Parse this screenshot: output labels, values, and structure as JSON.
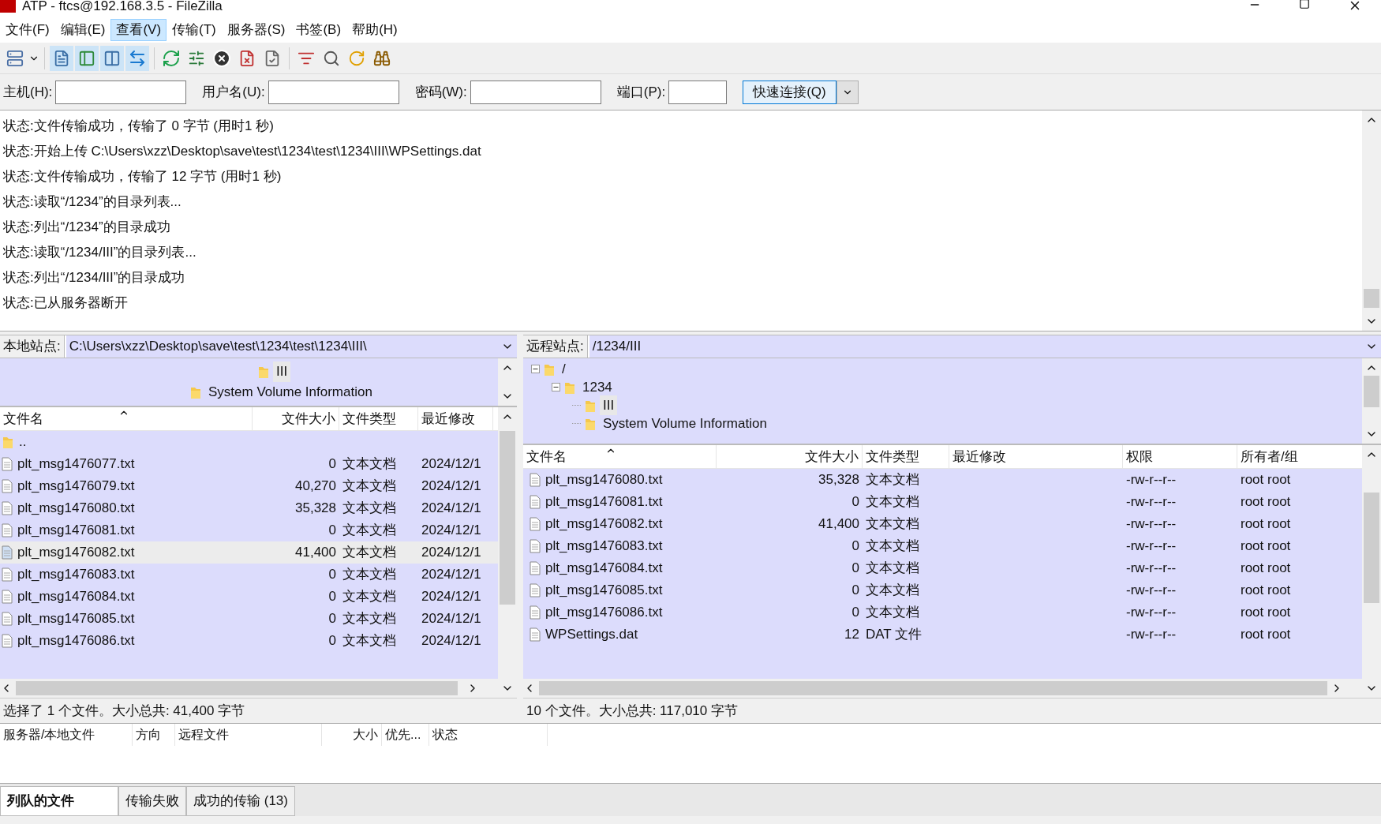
{
  "window": {
    "title": "ATP - ftcs@192.168.3.5 - FileZilla"
  },
  "menu": [
    {
      "label": "文件(F)",
      "selected": false
    },
    {
      "label": "编辑(E)",
      "selected": false
    },
    {
      "label": "查看(V)",
      "selected": true
    },
    {
      "label": "传输(T)",
      "selected": false
    },
    {
      "label": "服务器(S)",
      "selected": false
    },
    {
      "label": "书签(B)",
      "selected": false
    },
    {
      "label": "帮助(H)",
      "selected": false
    }
  ],
  "quickconnect": {
    "fields": [
      {
        "label": "主机(H):"
      },
      {
        "label": "用户名(U):"
      },
      {
        "label": "密码(W):"
      },
      {
        "label": "端口(P):"
      }
    ],
    "button": "快速连接(Q)"
  },
  "log": [
    "状态:文件传输成功，传输了 0 字节 (用时1 秒)",
    "状态:开始上传 C:\\Users\\xzz\\Desktop\\save\\test\\1234\\test\\1234\\III\\WPSettings.dat",
    "状态:文件传输成功，传输了 12 字节 (用时1 秒)",
    "状态:读取“/1234”的目录列表...",
    "状态:列出“/1234”的目录成功",
    "状态:读取“/1234/III”的目录列表...",
    "状态:列出“/1234/III”的目录成功",
    "状态:已从服务器断开"
  ],
  "local": {
    "label": "本地站点:",
    "path": "C:\\Users\\xzz\\Desktop\\save\\test\\1234\\test\\1234\\III\\",
    "tree": [
      {
        "name": "III",
        "selected": true
      },
      {
        "name": "System Volume Information",
        "selected": false
      }
    ],
    "columns": [
      "文件名",
      "文件大小",
      "文件类型",
      "最近修改"
    ],
    "rows": [
      {
        "kind": "folder",
        "name": "..",
        "size": "",
        "type": "",
        "modified": "",
        "selected": false
      },
      {
        "kind": "file",
        "name": "plt_msg1476077.txt",
        "size": "0",
        "type": "文本文档",
        "modified": "2024/12/1",
        "selected": false
      },
      {
        "kind": "file",
        "name": "plt_msg1476079.txt",
        "size": "40,270",
        "type": "文本文档",
        "modified": "2024/12/1",
        "selected": false
      },
      {
        "kind": "file",
        "name": "plt_msg1476080.txt",
        "size": "35,328",
        "type": "文本文档",
        "modified": "2024/12/1",
        "selected": false
      },
      {
        "kind": "file",
        "name": "plt_msg1476081.txt",
        "size": "0",
        "type": "文本文档",
        "modified": "2024/12/1",
        "selected": false
      },
      {
        "kind": "file",
        "name": "plt_msg1476082.txt",
        "size": "41,400",
        "type": "文本文档",
        "modified": "2024/12/1",
        "selected": true
      },
      {
        "kind": "file",
        "name": "plt_msg1476083.txt",
        "size": "0",
        "type": "文本文档",
        "modified": "2024/12/1",
        "selected": false
      },
      {
        "kind": "file",
        "name": "plt_msg1476084.txt",
        "size": "0",
        "type": "文本文档",
        "modified": "2024/12/1",
        "selected": false
      },
      {
        "kind": "file",
        "name": "plt_msg1476085.txt",
        "size": "0",
        "type": "文本文档",
        "modified": "2024/12/1",
        "selected": false
      },
      {
        "kind": "file",
        "name": "plt_msg1476086.txt",
        "size": "0",
        "type": "文本文档",
        "modified": "2024/12/1",
        "selected": false
      }
    ],
    "status": "选择了 1 个文件。大小总共: 41,400 字节"
  },
  "remote": {
    "label": "远程站点:",
    "path": "/1234/III",
    "tree": [
      {
        "name": "/",
        "expanded": true,
        "selected": false,
        "children": [
          {
            "name": "1234",
            "expanded": true,
            "selected": false,
            "children": [
              {
                "name": "III",
                "selected": true
              },
              {
                "name": "System Volume Information",
                "selected": false
              }
            ]
          }
        ]
      }
    ],
    "columns": [
      "文件名",
      "文件大小",
      "文件类型",
      "最近修改",
      "权限",
      "所有者/组"
    ],
    "rows": [
      {
        "name": "plt_msg1476080.txt",
        "size": "35,328",
        "type": "文本文档",
        "permissions": "-rw-r--r--",
        "owner": "root root"
      },
      {
        "name": "plt_msg1476081.txt",
        "size": "0",
        "type": "文本文档",
        "permissions": "-rw-r--r--",
        "owner": "root root"
      },
      {
        "name": "plt_msg1476082.txt",
        "size": "41,400",
        "type": "文本文档",
        "permissions": "-rw-r--r--",
        "owner": "root root"
      },
      {
        "name": "plt_msg1476083.txt",
        "size": "0",
        "type": "文本文档",
        "permissions": "-rw-r--r--",
        "owner": "root root"
      },
      {
        "name": "plt_msg1476084.txt",
        "size": "0",
        "type": "文本文档",
        "permissions": "-rw-r--r--",
        "owner": "root root"
      },
      {
        "name": "plt_msg1476085.txt",
        "size": "0",
        "type": "文本文档",
        "permissions": "-rw-r--r--",
        "owner": "root root"
      },
      {
        "name": "plt_msg1476086.txt",
        "size": "0",
        "type": "文本文档",
        "permissions": "-rw-r--r--",
        "owner": "root root"
      },
      {
        "name": "WPSettings.dat",
        "size": "12",
        "type": "DAT 文件",
        "permissions": "-rw-r--r--",
        "owner": "root root"
      }
    ],
    "status": "10 个文件。大小总共: 117,010 字节"
  },
  "queue": {
    "columns": [
      "服务器/本地文件",
      "方向",
      "远程文件",
      "大小",
      "优先...",
      "状态"
    ]
  },
  "tabs": [
    {
      "label": "列队的文件",
      "selected": true
    },
    {
      "label": "传输失败",
      "selected": false
    },
    {
      "label": "成功的传输 (13)",
      "selected": false
    }
  ]
}
